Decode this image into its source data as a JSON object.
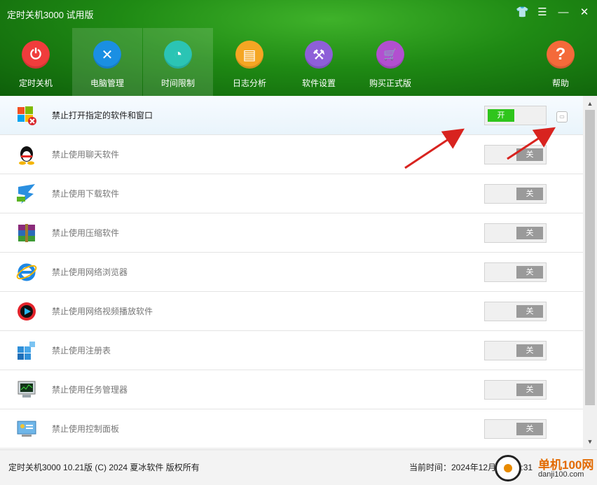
{
  "app": {
    "title": "定时关机3000 试用版"
  },
  "window_controls": [
    {
      "name": "skin-icon",
      "glyph": "👕"
    },
    {
      "name": "menu-icon",
      "glyph": "☰"
    },
    {
      "name": "minimize-icon",
      "glyph": "—"
    },
    {
      "name": "close-icon",
      "glyph": "✕"
    }
  ],
  "nav": [
    {
      "label": "定时关机",
      "icon": "power-icon",
      "glyph": "⏻",
      "color": "#f03c3c",
      "active": false
    },
    {
      "label": "电脑管理",
      "icon": "tools-icon",
      "glyph": "✕",
      "color": "#1a8fe3",
      "active": true
    },
    {
      "label": "时间限制",
      "icon": "timer-icon",
      "glyph": "◔",
      "color": "#2bc4b4",
      "active": true
    },
    {
      "label": "日志分析",
      "icon": "log-icon",
      "glyph": "▤",
      "color": "#f5a623",
      "active": false
    },
    {
      "label": "软件设置",
      "icon": "settings-icon",
      "glyph": "⚒",
      "color": "#8e5fd8",
      "active": false
    },
    {
      "label": "购买正式版",
      "icon": "cart-icon",
      "glyph": "🛒",
      "color": "#b24fd0",
      "active": false
    },
    {
      "label": "帮助",
      "icon": "help-icon",
      "glyph": "?",
      "color": "#f46a3a",
      "active": false
    }
  ],
  "rows": [
    {
      "label": "禁止打开指定的软件和窗口",
      "icon": "windows-forbidden-icon",
      "state": "开",
      "on": true,
      "selected": true
    },
    {
      "label": "禁止使用聊天软件",
      "icon": "qq-penguin-icon",
      "state": "关",
      "on": false
    },
    {
      "label": "禁止使用下载软件",
      "icon": "thunder-download-icon",
      "state": "关",
      "on": false
    },
    {
      "label": "禁止使用压缩软件",
      "icon": "winrar-icon",
      "state": "关",
      "on": false
    },
    {
      "label": "禁止使用网络浏览器",
      "icon": "ie-browser-icon",
      "state": "关",
      "on": false
    },
    {
      "label": "禁止使用网络视频播放软件",
      "icon": "video-player-icon",
      "state": "关",
      "on": false
    },
    {
      "label": "禁止使用注册表",
      "icon": "registry-icon",
      "state": "关",
      "on": false
    },
    {
      "label": "禁止使用任务管理器",
      "icon": "task-manager-icon",
      "state": "关",
      "on": false
    },
    {
      "label": "禁止使用控制面板",
      "icon": "control-panel-icon",
      "state": "关",
      "on": false
    }
  ],
  "footer": {
    "copyright": "定时关机3000 10.21版 (C) 2024 夏冰软件 版权所有",
    "time": "当前时间：2024年12月1日 14:31"
  },
  "watermark": {
    "site": "单机100网",
    "url": "danji100.com"
  }
}
